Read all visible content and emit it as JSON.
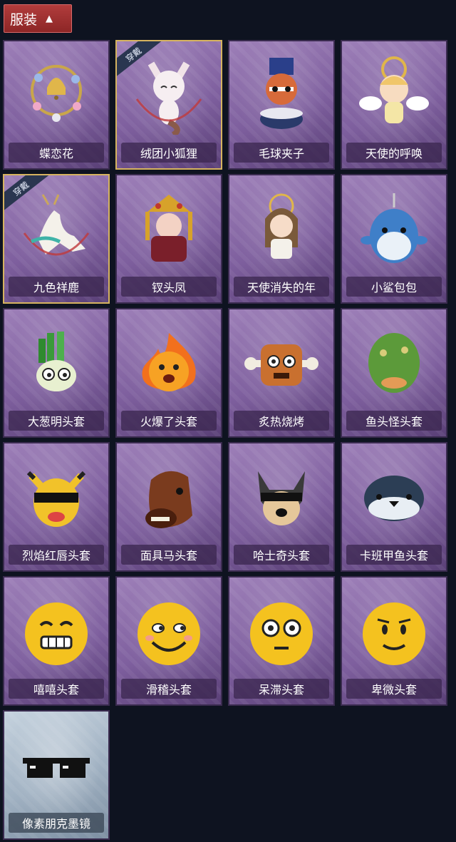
{
  "header": {
    "title": "服装"
  },
  "badge_text": "穿戴",
  "items": [
    {
      "name": "蝶恋花",
      "art": "bell-wreath",
      "equipped": false,
      "rarity": "purple"
    },
    {
      "name": "绒团小狐狸",
      "art": "white-fox",
      "equipped": true,
      "rarity": "purple"
    },
    {
      "name": "毛球夹子",
      "art": "raccoon-drummer",
      "equipped": false,
      "rarity": "purple"
    },
    {
      "name": "天使的呼唤",
      "art": "angel-doll",
      "equipped": false,
      "rarity": "purple"
    },
    {
      "name": "九色祥鹿",
      "art": "deer",
      "equipped": true,
      "rarity": "purple"
    },
    {
      "name": "钗头凤",
      "art": "opera-doll",
      "equipped": false,
      "rarity": "purple"
    },
    {
      "name": "天使消失的年",
      "art": "girl-doll",
      "equipped": false,
      "rarity": "purple"
    },
    {
      "name": "小鲨包包",
      "art": "shark",
      "equipped": false,
      "rarity": "purple"
    },
    {
      "name": "大葱明头套",
      "art": "green-onion",
      "equipped": false,
      "rarity": "purple"
    },
    {
      "name": "火爆了头套",
      "art": "fire",
      "equipped": false,
      "rarity": "purple"
    },
    {
      "name": "炙热烧烤",
      "art": "meat",
      "equipped": false,
      "rarity": "purple"
    },
    {
      "name": "鱼头怪头套",
      "art": "fish-head",
      "equipped": false,
      "rarity": "purple"
    },
    {
      "name": "烈焰红唇头套",
      "art": "yellow-mask",
      "equipped": false,
      "rarity": "purple"
    },
    {
      "name": "面具马头套",
      "art": "horse-head",
      "equipped": false,
      "rarity": "purple"
    },
    {
      "name": "哈士奇头套",
      "art": "husky",
      "equipped": false,
      "rarity": "purple"
    },
    {
      "name": "卡班甲鱼头套",
      "art": "fish",
      "equipped": false,
      "rarity": "purple"
    },
    {
      "name": "嘻嘻头套",
      "art": "emoji-grin",
      "equipped": false,
      "rarity": "purple"
    },
    {
      "name": "滑稽头套",
      "art": "emoji-funny",
      "equipped": false,
      "rarity": "purple"
    },
    {
      "name": "呆滞头套",
      "art": "emoji-stare",
      "equipped": false,
      "rarity": "purple"
    },
    {
      "name": "卑微头套",
      "art": "emoji-humble",
      "equipped": false,
      "rarity": "purple"
    },
    {
      "name": "像素朋克墨镜",
      "art": "pixel-glasses",
      "equipped": false,
      "rarity": "silver"
    }
  ],
  "colors": {
    "background": "#0e1320",
    "header": "#b13c3c",
    "card_purple": "#8c6dab",
    "card_silver": "#aebdcc",
    "equipped_border": "#d6b35f"
  }
}
